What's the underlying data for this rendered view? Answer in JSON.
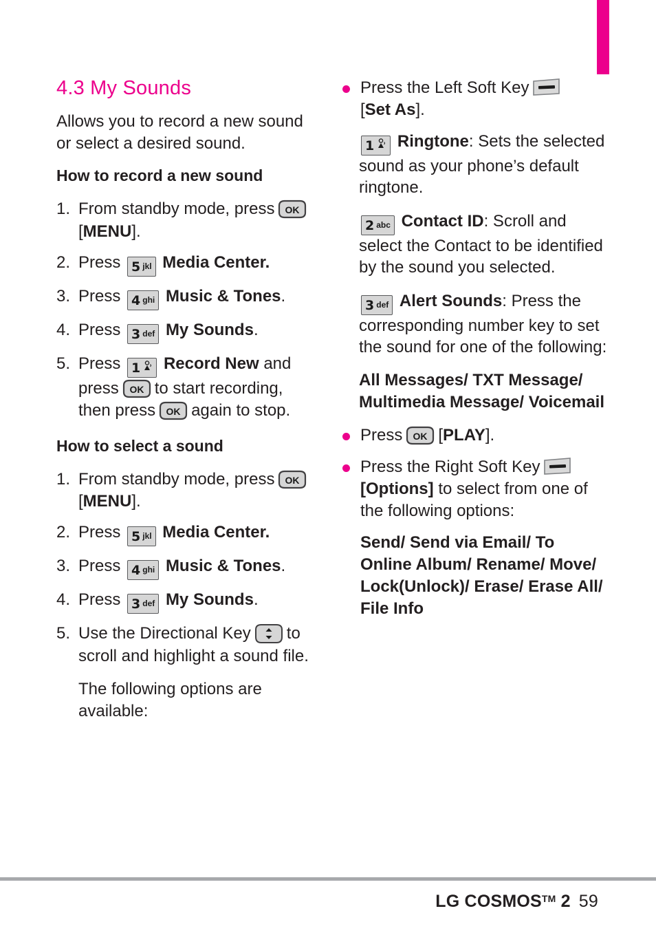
{
  "page": {
    "number": "59",
    "footer_brand": "LG COSMOS",
    "footer_tm": "TM",
    "footer_model": "2",
    "tab_color": "#ec008c"
  },
  "section": {
    "title": "4.3 My Sounds",
    "intro": "Allows you to record a new sound or select a desired sound."
  },
  "record": {
    "heading": "How to record a new sound",
    "steps": [
      {
        "num": "1.",
        "pre": "From standby mode, press",
        "key": "OK",
        "post": "[MENU].",
        "post_bold": "MENU"
      },
      {
        "num": "2.",
        "pre": "Press",
        "key_digit": "5",
        "key_letters": "jkl",
        "post_bold": "Media Center",
        "post": "."
      },
      {
        "num": "3.",
        "pre": "Press",
        "key_digit": "4",
        "key_letters": "ghi",
        "post_bold": "Music & Tones",
        "post": "."
      },
      {
        "num": "4.",
        "pre": "Press",
        "key_digit": "3",
        "key_letters": "def",
        "post_bold": "My Sounds",
        "post": "."
      },
      {
        "num": "5.",
        "pre": "Press",
        "key_digit": "1",
        "key_letters": "voicemail-icon",
        "post_bold": "Record New",
        "mid1": "and press",
        "mid2": "to start recording, then press",
        "mid3": "again to stop."
      }
    ]
  },
  "select": {
    "heading": "How to select a sound",
    "steps": [
      {
        "num": "1.",
        "pre": "From standby mode, press",
        "key": "OK",
        "post": "[MENU].",
        "post_bold": "MENU"
      },
      {
        "num": "2.",
        "pre": "Press",
        "key_digit": "5",
        "key_letters": "jkl",
        "post_bold": "Media Center",
        "post": "."
      },
      {
        "num": "3.",
        "pre": "Press",
        "key_digit": "4",
        "key_letters": "ghi",
        "post_bold": "Music & Tones",
        "post": "."
      },
      {
        "num": "4.",
        "pre": "Press",
        "key_digit": "3",
        "key_letters": "def",
        "post_bold": "My Sounds",
        "post": "."
      },
      {
        "num": "5.",
        "pre": "Use the Directional Key",
        "post": "to scroll and highlight a sound file."
      }
    ],
    "following_options": "The following options are available:"
  },
  "right": {
    "bullet1_pre": "Press the Left Soft Key",
    "bullet1_post_open": "[",
    "bullet1_post_bold": "Set As",
    "bullet1_post_close": "].",
    "ringtone": {
      "key_digit": "1",
      "key_letters": "voicemail-icon",
      "label": "Ringtone",
      "text": ": Sets the selected sound as your phone’s default ringtone."
    },
    "contact_id": {
      "key_digit": "2",
      "key_letters": "abc",
      "label": "Contact ID",
      "text": ": Scroll and select the Contact to be identified by the sound you selected."
    },
    "alert_sounds": {
      "key_digit": "3",
      "key_letters": "def",
      "label": "Alert Sounds",
      "text": ": Press the corresponding number key to set the sound for one of the following:"
    },
    "alert_options": "All Messages/ TXT Message/ Multimedia Message/ Voicemail",
    "bullet2_pre": "Press",
    "bullet2_key": "OK",
    "bullet2_post": "[PLAY].",
    "bullet2_post_bold": "PLAY",
    "bullet3_pre": "Press the Right Soft Key",
    "bullet3_bold": "[Options]",
    "bullet3_post": "to select from one of the following options:",
    "options_list": "Send/ Send via Email/ To Online Album/ Rename/ Move/ Lock(Unlock)/ Erase/ Erase All/ File Info"
  },
  "icons": {
    "ok_key": "ok-key-icon",
    "soft_key": "soft-key-icon",
    "directional_key": "directional-key-icon",
    "voicemail": "voicemail-icon"
  }
}
